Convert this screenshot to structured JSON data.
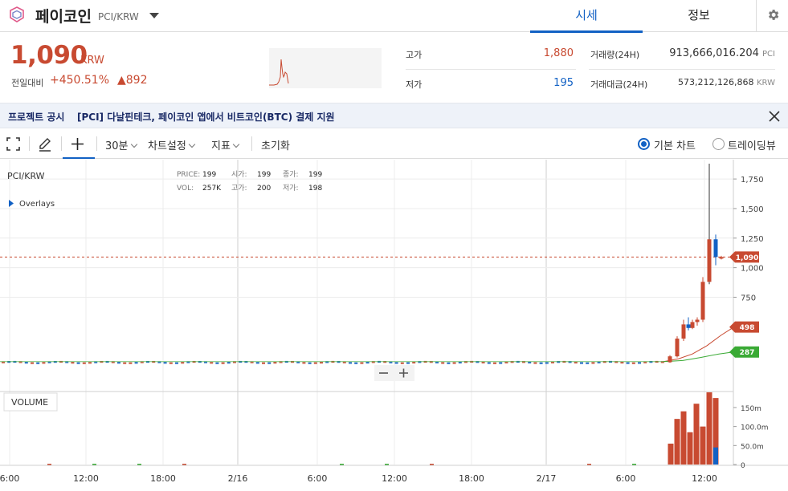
{
  "header": {
    "coin_name": "페이코인",
    "pair": "PCI/KRW",
    "tabs": [
      {
        "label": "시세",
        "active": true
      },
      {
        "label": "정보",
        "active": false
      }
    ]
  },
  "summary": {
    "price": "1,090",
    "unit": "KRW",
    "change_label": "전일대비",
    "change_rate": "+450.51%",
    "change_abs": "▲892",
    "high_label": "고가",
    "high_value": "1,880",
    "low_label": "저가",
    "low_value": "195",
    "volume_label": "거래량(24H)",
    "volume_value": "913,666,016.204",
    "volume_unit": "PCI",
    "amount_label": "거래대금(24H)",
    "amount_value": "573,212,126,868",
    "amount_unit": "KRW"
  },
  "notice": {
    "tag": "프로젝트 공시",
    "text": "[PCI] 다날핀테크, 페이코인 앱에서 비트코인(BTC) 결제 지원"
  },
  "toolbar": {
    "interval": "30분",
    "chart_settings": "차트설정",
    "indicators": "지표",
    "reset": "초기화",
    "basic_chart": "기본 차트",
    "tradingview": "트레이딩뷰"
  },
  "chart_data": {
    "type": "candlestick",
    "symbol": "PCI/KRW",
    "overlays_label": "Overlays",
    "volume_label": "VOLUME",
    "ohlc_readout": {
      "labels": [
        "PRICE:",
        "시가:",
        "종가:",
        "VOL:",
        "고가:",
        "저가:"
      ],
      "values": [
        "199",
        "199",
        "199",
        "257K",
        "200",
        "198"
      ]
    },
    "price_axis": [
      "1,750",
      "1,500",
      "1,250",
      "1,000",
      "750"
    ],
    "price_ylim": [
      0,
      1900
    ],
    "volume_axis": [
      "150m",
      "100.0m",
      "50.0m",
      "0"
    ],
    "volume_ylim": [
      0,
      190
    ],
    "time_labels": [
      "6:00",
      "12:00",
      "18:00",
      "2/16",
      "6:00",
      "12:00",
      "18:00",
      "2/17",
      "6:00",
      "12:00"
    ],
    "current_price": 1090,
    "current_price_label": "1,090",
    "ma_tags": [
      {
        "value": 498,
        "label": "498",
        "color": "#c84a31"
      },
      {
        "value": 287,
        "label": "287",
        "color": "#3aaa35"
      }
    ],
    "colors": {
      "up": "#c84a31",
      "down": "#1261c4",
      "ma_short": "#c84a31",
      "ma_long": "#3aaa35"
    },
    "recent_candles": [
      {
        "o": 200,
        "h": 260,
        "l": 195,
        "c": 250
      },
      {
        "o": 250,
        "h": 420,
        "l": 240,
        "c": 400
      },
      {
        "o": 400,
        "h": 560,
        "l": 380,
        "c": 520
      },
      {
        "o": 520,
        "h": 580,
        "l": 470,
        "c": 490
      },
      {
        "o": 490,
        "h": 560,
        "l": 480,
        "c": 540
      },
      {
        "o": 540,
        "h": 580,
        "l": 510,
        "c": 560
      },
      {
        "o": 560,
        "h": 920,
        "l": 540,
        "c": 880
      },
      {
        "o": 880,
        "h": 1880,
        "l": 860,
        "c": 1240
      },
      {
        "o": 1240,
        "h": 1280,
        "l": 1020,
        "c": 1090
      },
      {
        "o": 1090,
        "h": 1100,
        "l": 1070,
        "c": 1090
      }
    ],
    "recent_volume_m": [
      55,
      120,
      140,
      85,
      160,
      100,
      190,
      175,
      45,
      0
    ]
  }
}
